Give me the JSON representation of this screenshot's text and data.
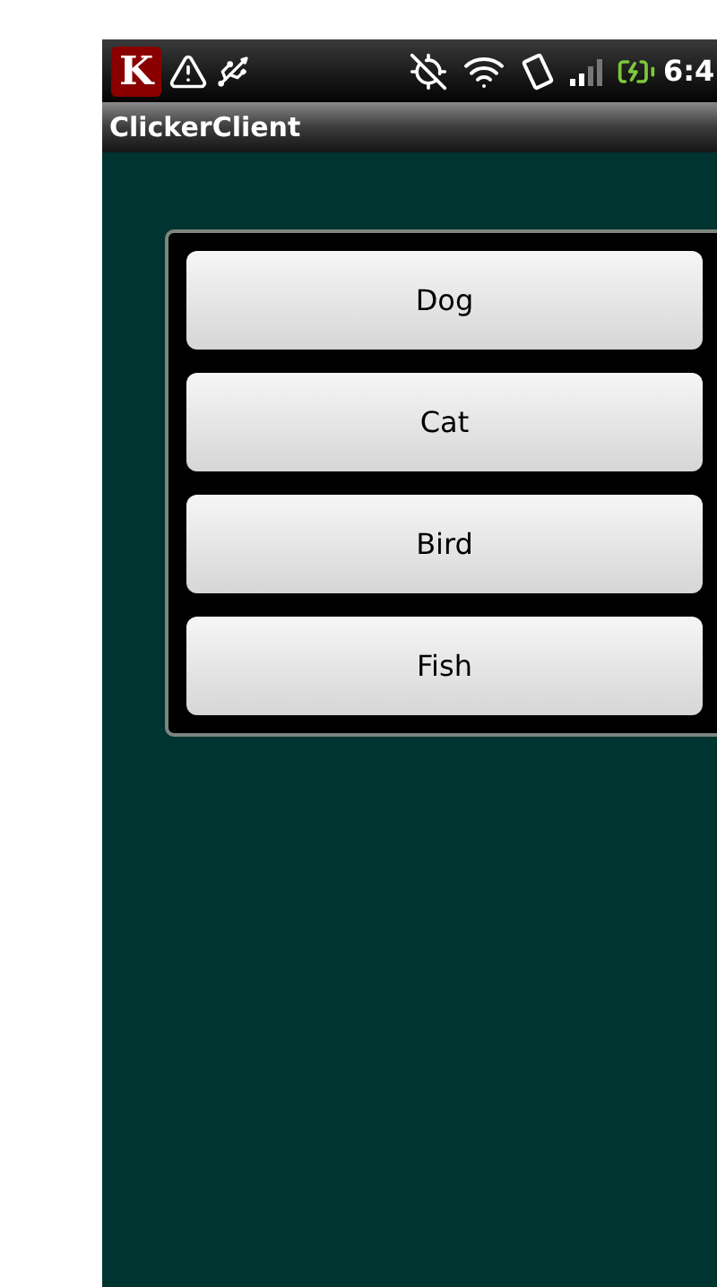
{
  "status_bar": {
    "app_badge": "K",
    "time": "6:4"
  },
  "title_bar": {
    "title": "ClickerClient"
  },
  "buttons": [
    {
      "label": "Dog"
    },
    {
      "label": "Cat"
    },
    {
      "label": "Bird"
    },
    {
      "label": "Fish"
    }
  ]
}
